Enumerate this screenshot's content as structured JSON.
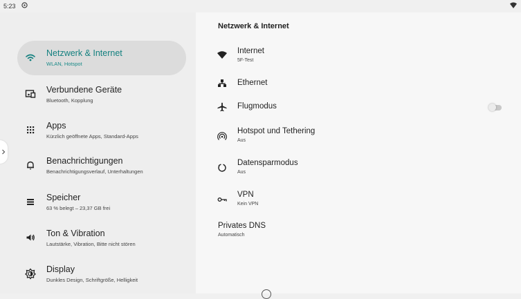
{
  "status_bar": {
    "time": "5:23"
  },
  "nav": {
    "items": [
      {
        "title": "Netzwerk & Internet",
        "subtitle": "WLAN, Hotspot",
        "icon": "wifi-icon",
        "selected": true
      },
      {
        "title": "Verbundene Geräte",
        "subtitle": "Bluetooth, Kopplung",
        "icon": "connected-devices-icon"
      },
      {
        "title": "Apps",
        "subtitle": "Kürzlich geöffnete Apps, Standard-Apps",
        "icon": "apps-grid-icon"
      },
      {
        "title": "Benachrichtigungen",
        "subtitle": "Benachrichtigungsverlauf, Unterhaltungen",
        "icon": "bell-icon"
      },
      {
        "title": "Speicher",
        "subtitle": "63 % belegt – 23,37 GB frei",
        "icon": "storage-icon"
      },
      {
        "title": "Ton & Vibration",
        "subtitle": "Lautstärke, Vibration, Bitte nicht stören",
        "icon": "volume-icon"
      },
      {
        "title": "Display",
        "subtitle": "Dunkles Design, Schriftgröße, Helligkeit",
        "icon": "brightness-icon"
      }
    ]
  },
  "detail": {
    "title": "Netzwerk & Internet",
    "rows": [
      {
        "title": "Internet",
        "subtitle": "5F-Test",
        "icon": "wifi-filled-icon"
      },
      {
        "title": "Ethernet",
        "icon": "ethernet-icon"
      },
      {
        "title": "Flugmodus",
        "icon": "airplane-icon",
        "toggle": false
      },
      {
        "title": "Hotspot und Tethering",
        "subtitle": "Aus",
        "icon": "hotspot-icon"
      },
      {
        "title": "Datensparmodus",
        "subtitle": "Aus",
        "icon": "data-saver-icon"
      },
      {
        "title": "VPN",
        "subtitle": "Kein VPN",
        "icon": "vpn-key-icon"
      },
      {
        "title": "Privates DNS",
        "subtitle": "Automatisch"
      }
    ]
  },
  "colors": {
    "accent": "#13807f",
    "selected_bg": "#dcdcdc",
    "left_bg": "#eeeeee",
    "right_bg": "#f7f7f7"
  }
}
